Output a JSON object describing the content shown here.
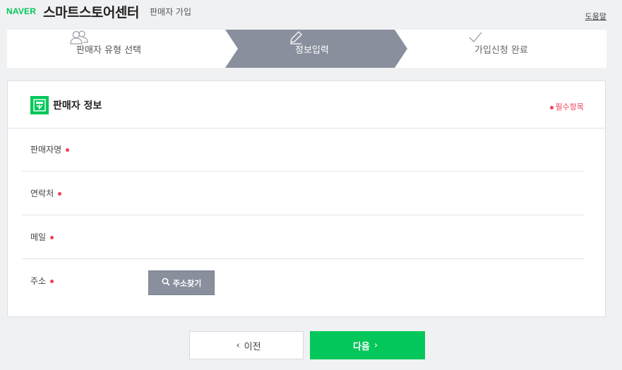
{
  "header": {
    "logo": "NAVER",
    "brand": "스마트스토어센터",
    "subtitle": "판매자 가입",
    "help": "도움말"
  },
  "steps": [
    {
      "label": "판매자 유형 선택",
      "icon": "users-icon",
      "active": false
    },
    {
      "label": "정보입력",
      "icon": "pencil-icon",
      "active": true
    },
    {
      "label": "가입신청 완료",
      "icon": "check-icon",
      "active": false
    }
  ],
  "section": {
    "title": "판매자 정보",
    "icon": "seller-id-icon",
    "required_note": "필수항목"
  },
  "fields": [
    {
      "label": "판매자명",
      "required": true
    },
    {
      "label": "연락처",
      "required": true
    },
    {
      "label": "메일",
      "required": true
    },
    {
      "label": "주소",
      "required": true
    }
  ],
  "address_button": "주소찾기",
  "buttons": {
    "prev": "이전",
    "next": "다음"
  },
  "colors": {
    "brand_green": "#03c75a",
    "active_step": "#8a8f9d",
    "required_red": "#f2405a"
  }
}
